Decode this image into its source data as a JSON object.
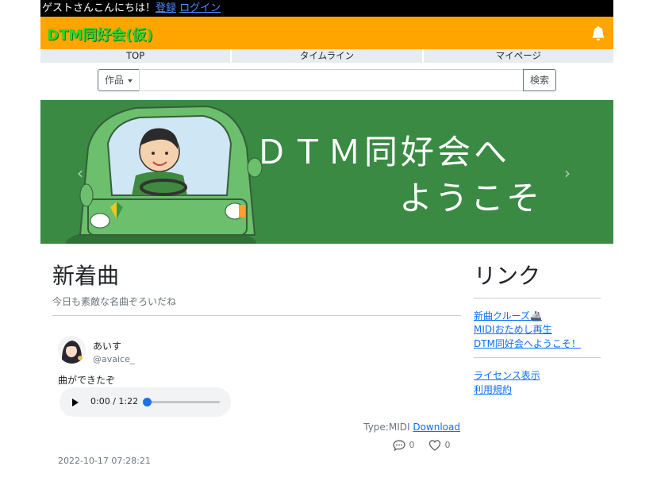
{
  "topbar": {
    "greeting": "ゲストさんこんにちは！",
    "register": "登録",
    "login": "ログイン"
  },
  "brand": {
    "title": "DTM同好会(仮)"
  },
  "nav": {
    "tabs": [
      {
        "label": "TOP"
      },
      {
        "label": "タイムライン"
      },
      {
        "label": "マイページ"
      }
    ]
  },
  "search": {
    "dropdown_label": "作品",
    "value": "",
    "button_label": "検索"
  },
  "banner": {
    "line1": "ＤＴＭ同好会へ",
    "line2": "ようこそ",
    "prev": "‹",
    "next": "›"
  },
  "main": {
    "title": "新着曲",
    "subtitle": "今日も素敵な名曲ぞろいだね",
    "post": {
      "user_name": "あいす",
      "user_handle": "@avaice_",
      "text": "曲ができたぞ",
      "audio_time": "0:00 / 1:22",
      "audio_progress": 0,
      "type_label": "Type:MIDI",
      "download_label": "Download",
      "comments": "0",
      "likes": "0",
      "date": "2022-10-17 07:28:21"
    }
  },
  "side": {
    "title": "リンク",
    "links": [
      {
        "label": "新曲クルーズ🚢"
      },
      {
        "label": "MIDIおためし再生"
      },
      {
        "label": "DTM同好会へようこそ！"
      }
    ],
    "links2": [
      {
        "label": "ライセンス表示"
      },
      {
        "label": "利用規約"
      }
    ]
  },
  "colors": {
    "header": "#ffa500",
    "brand": "#2ed42e",
    "banner": "#3a8a44",
    "link": "#0d6efd"
  }
}
